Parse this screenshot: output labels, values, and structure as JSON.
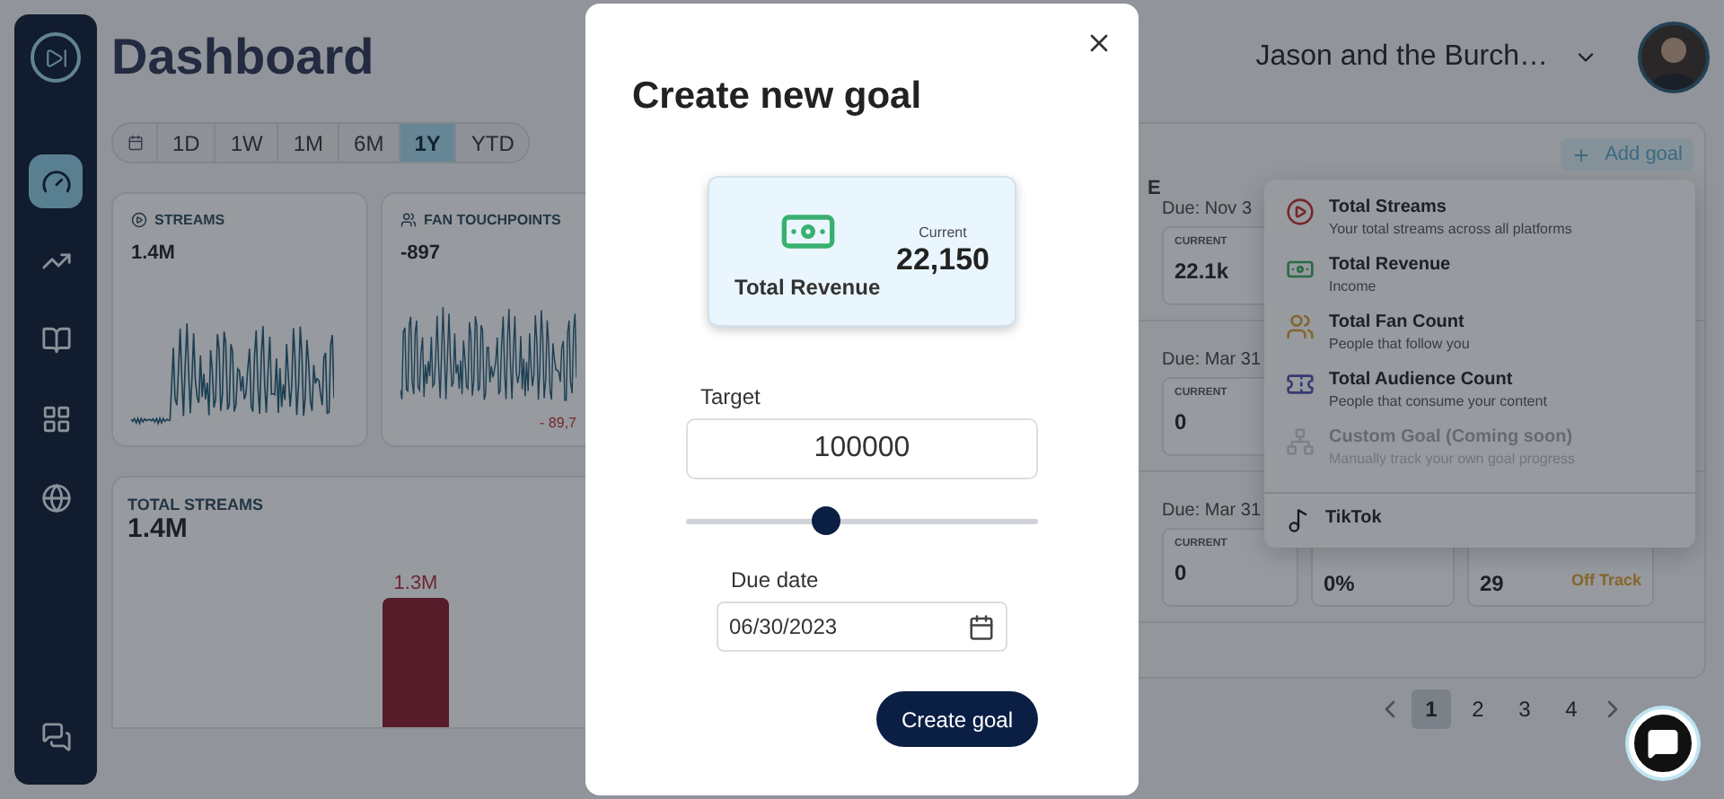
{
  "sidebar": {
    "items": [
      {
        "selected": true
      },
      {
        "selected": false
      },
      {
        "selected": false
      },
      {
        "selected": false
      },
      {
        "selected": false
      }
    ]
  },
  "header": {
    "title": "Dashboard",
    "account": "Jason and the Burch…"
  },
  "range": {
    "options": [
      {
        "label": "1D",
        "selected": false
      },
      {
        "label": "1W",
        "selected": false
      },
      {
        "label": "1M",
        "selected": false
      },
      {
        "label": "6M",
        "selected": false
      },
      {
        "label": "1Y",
        "selected": true
      },
      {
        "label": "YTD",
        "selected": false
      }
    ]
  },
  "metric_cards": [
    {
      "kind": "streams",
      "title": "STREAMS",
      "value": "1.4M"
    },
    {
      "kind": "fans",
      "title": "FAN TOUCHPOINTS",
      "value": "-897",
      "change": "- 89,7"
    }
  ],
  "total_streams": {
    "title": "TOTAL STREAMS",
    "value": "1.4M",
    "bar_label": "1.3M"
  },
  "goals_panel": {
    "add_button": "Add goal",
    "heading_fragment": "E",
    "goals": [
      {
        "due": "Due: Nov 3",
        "boxes": [
          {
            "kind": "current",
            "label": "CURRENT",
            "value": "22.1k"
          }
        ]
      },
      {
        "due": "Due: Mar 31",
        "boxes": [
          {
            "kind": "current",
            "label": "CURRENT",
            "value": "0"
          }
        ]
      },
      {
        "due": "Due: Mar 31",
        "boxes": [
          {
            "kind": "current",
            "label": "CURRENT",
            "value": "0"
          },
          {
            "kind": "progress",
            "value": "0%",
            "level": 0
          },
          {
            "kind": "status",
            "value": "29",
            "status": "Off Track"
          }
        ]
      }
    ],
    "pagination": [
      {
        "label": "1",
        "selected": true
      },
      {
        "label": "2",
        "selected": false
      },
      {
        "label": "3",
        "selected": false
      },
      {
        "label": "4",
        "selected": false
      }
    ]
  },
  "add_goal_menu": {
    "items": [
      {
        "kind": "streams",
        "title": "Total Streams",
        "subtitle": "Your total streams across all platforms",
        "disabled": false
      },
      {
        "kind": "revenue",
        "title": "Total Revenue",
        "subtitle": "Income",
        "disabled": false
      },
      {
        "kind": "fans",
        "title": "Total Fan Count",
        "subtitle": "People that follow you",
        "disabled": false
      },
      {
        "kind": "audience",
        "title": "Total Audience Count",
        "subtitle": "People that consume your content",
        "disabled": false
      },
      {
        "kind": "custom",
        "title": "Custom Goal (Coming soon)",
        "subtitle": "Manually track your own goal progress",
        "disabled": true
      }
    ],
    "platform": "TikTok"
  },
  "modal": {
    "title": "Create new goal",
    "goal_card": {
      "name": "Total Revenue",
      "current_label": "Current",
      "current_value": "22,150"
    },
    "target": {
      "label": "Target",
      "value": "100000",
      "level": 0.4
    },
    "due_date": {
      "label": "Due date",
      "value": "06/30/2023"
    },
    "submit": "Create goal"
  }
}
